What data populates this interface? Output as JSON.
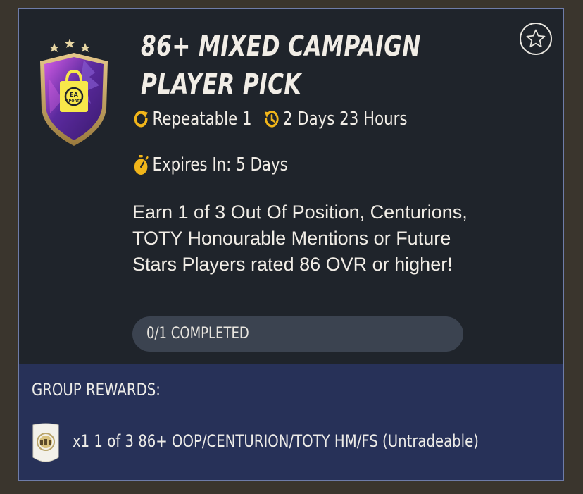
{
  "objective": {
    "title_line1": "86+ MIXED CAMPAIGN",
    "title_line2": "PLAYER PICK",
    "repeatable": "Repeatable 1",
    "refresh_time": "2 Days 23 Hours",
    "expires": "Expires In: 5 Days",
    "description": "Earn 1 of 3 Out Of Position, Centurions, TOTY Honourable Mentions or Future Stars Players rated 86 OVR or higher!",
    "progress_label": "0/1 COMPLETED",
    "progress_fraction": 0
  },
  "rewards": {
    "heading": "GROUP REWARDS:",
    "item": "x1 1 of 3 86+ OOP/CENTURION/TOTY HM/FS (Untradeable)"
  },
  "icons": {
    "repeat": "repeat-icon",
    "history": "history-clock-icon",
    "timer": "stopwatch-icon",
    "favorite": "star-icon"
  },
  "colors": {
    "accent": "#f1b51a",
    "card_bg": "#1f242b",
    "rewards_bg": "#273158",
    "border": "#6e7ca8"
  }
}
